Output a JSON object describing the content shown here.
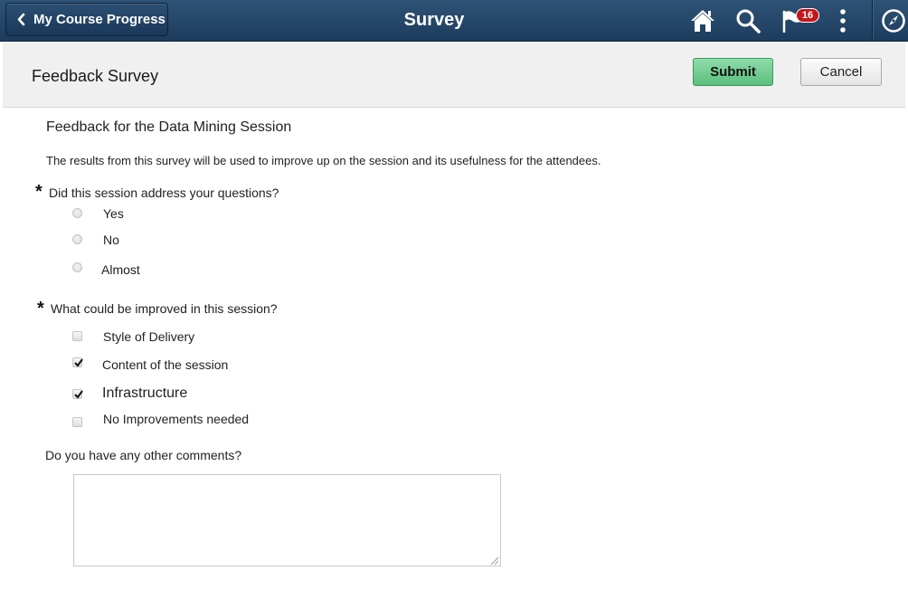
{
  "banner": {
    "back_label": "My Course Progress",
    "title": "Survey",
    "notification_count": "16",
    "icons": [
      "home-icon",
      "search-icon",
      "notification-flag-icon",
      "actions-menu-icon",
      "navbar-compass-icon"
    ]
  },
  "page_header": {
    "title": "Feedback Survey",
    "submit_label": "Submit",
    "cancel_label": "Cancel"
  },
  "survey": {
    "title": "Feedback for the Data Mining Session",
    "description": "The results from this survey will be used to improve up on the session and its usefulness for the attendees.",
    "q1": {
      "required_mark": "*",
      "label": "Did this session address your questions?",
      "options": [
        {
          "label": "Yes",
          "selected": false
        },
        {
          "label": "No",
          "selected": false
        },
        {
          "label": "Almost",
          "selected": false
        }
      ]
    },
    "q2": {
      "required_mark": "*",
      "label": "What could be improved in this session?",
      "options": [
        {
          "label": "Style of Delivery",
          "checked": false
        },
        {
          "label": "Content of the session",
          "checked": true
        },
        {
          "label": "Infrastructure",
          "checked": true
        },
        {
          "label": "No Improvements needed",
          "checked": false
        }
      ]
    },
    "q3": {
      "label": "Do you have any other comments?",
      "value": ""
    }
  },
  "colors": {
    "banner": "#1d3c5d",
    "submit": "#5cbf7e",
    "badge": "#c5161b",
    "header_bg": "#f0f0f0"
  }
}
